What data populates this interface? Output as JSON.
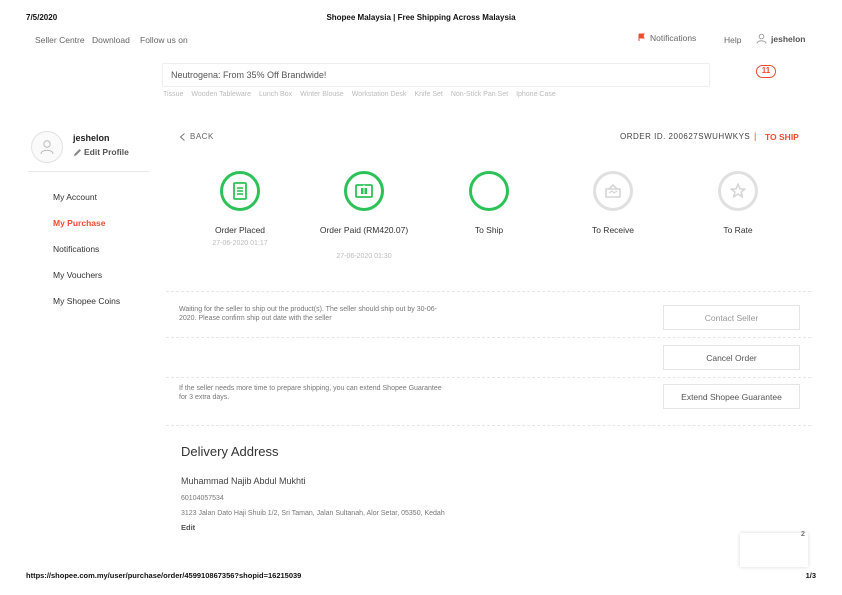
{
  "print": {
    "date": "7/5/2020",
    "title": "Shopee Malaysia | Free Shipping Across Malaysia",
    "url": "https://shopee.com.my/user/purchase/order/459910867356?shopid=16215039",
    "page": "1/3"
  },
  "topnav": {
    "seller_centre": "Seller Centre",
    "download": "Download",
    "follow_us": "Follow us on",
    "notifications": "Notifications",
    "help": "Help",
    "username": "jeshelon"
  },
  "search": {
    "placeholder": "Neutrogena: From 35% Off Brandwide!",
    "hot_keywords": [
      "Tissue",
      "Wooden Tableware",
      "Lunch Box",
      "Winter Blouse",
      "Workstation Desk",
      "Knife Set",
      "Non-Stick Pan Set",
      "Iphone Case"
    ]
  },
  "cart": {
    "count": "11"
  },
  "sidebar": {
    "username": "jeshelon",
    "edit_profile": "Edit Profile",
    "items": [
      {
        "label": "My Account"
      },
      {
        "label": "My Purchase"
      },
      {
        "label": "Notifications"
      },
      {
        "label": "My Vouchers"
      },
      {
        "label": "My Shopee Coins"
      }
    ],
    "active_index": 1
  },
  "order": {
    "back": "BACK",
    "order_id": "ORDER ID. 200627SWUHWKYS",
    "separator": "|",
    "status": "TO SHIP"
  },
  "steps": [
    {
      "label": "Order Placed",
      "time": "27-06-2020 01:17",
      "icon": "receipt-icon",
      "done": true
    },
    {
      "label": "Order Paid (RM420.07)",
      "time": "27-06-2020 01:30",
      "icon": "payment-icon",
      "done": true
    },
    {
      "label": "To Ship",
      "time": "",
      "icon": "",
      "done": true
    },
    {
      "label": "To Receive",
      "time": "",
      "icon": "box-icon",
      "done": false
    },
    {
      "label": "To Rate",
      "time": "",
      "icon": "star-icon",
      "done": false
    }
  ],
  "notices": {
    "waiting": "Waiting for the seller to ship out the product(s). The seller should ship out by 30-06-2020. Please confirm ship out date with the seller",
    "extend": "If the seller needs more time to prepare shipping, you can extend Shopee Guarantee for 3 extra days."
  },
  "buttons": {
    "contact_seller": "Contact Seller",
    "cancel_order": "Cancel Order",
    "extend_guarantee": "Extend Shopee Guarantee"
  },
  "address": {
    "title": "Delivery Address",
    "name": "Muhammad Najib Abdul Mukhti",
    "phone": "60104057534",
    "line": "3123 Jalan Dato Haji Shuib 1/2, Sri Taman, Jalan Sultanah, Alor Setar, 05350, Kedah",
    "edit": "Edit"
  },
  "widget": {
    "number": "2"
  },
  "colors": {
    "brand": "#ee4d2d",
    "success": "#2dc258"
  }
}
